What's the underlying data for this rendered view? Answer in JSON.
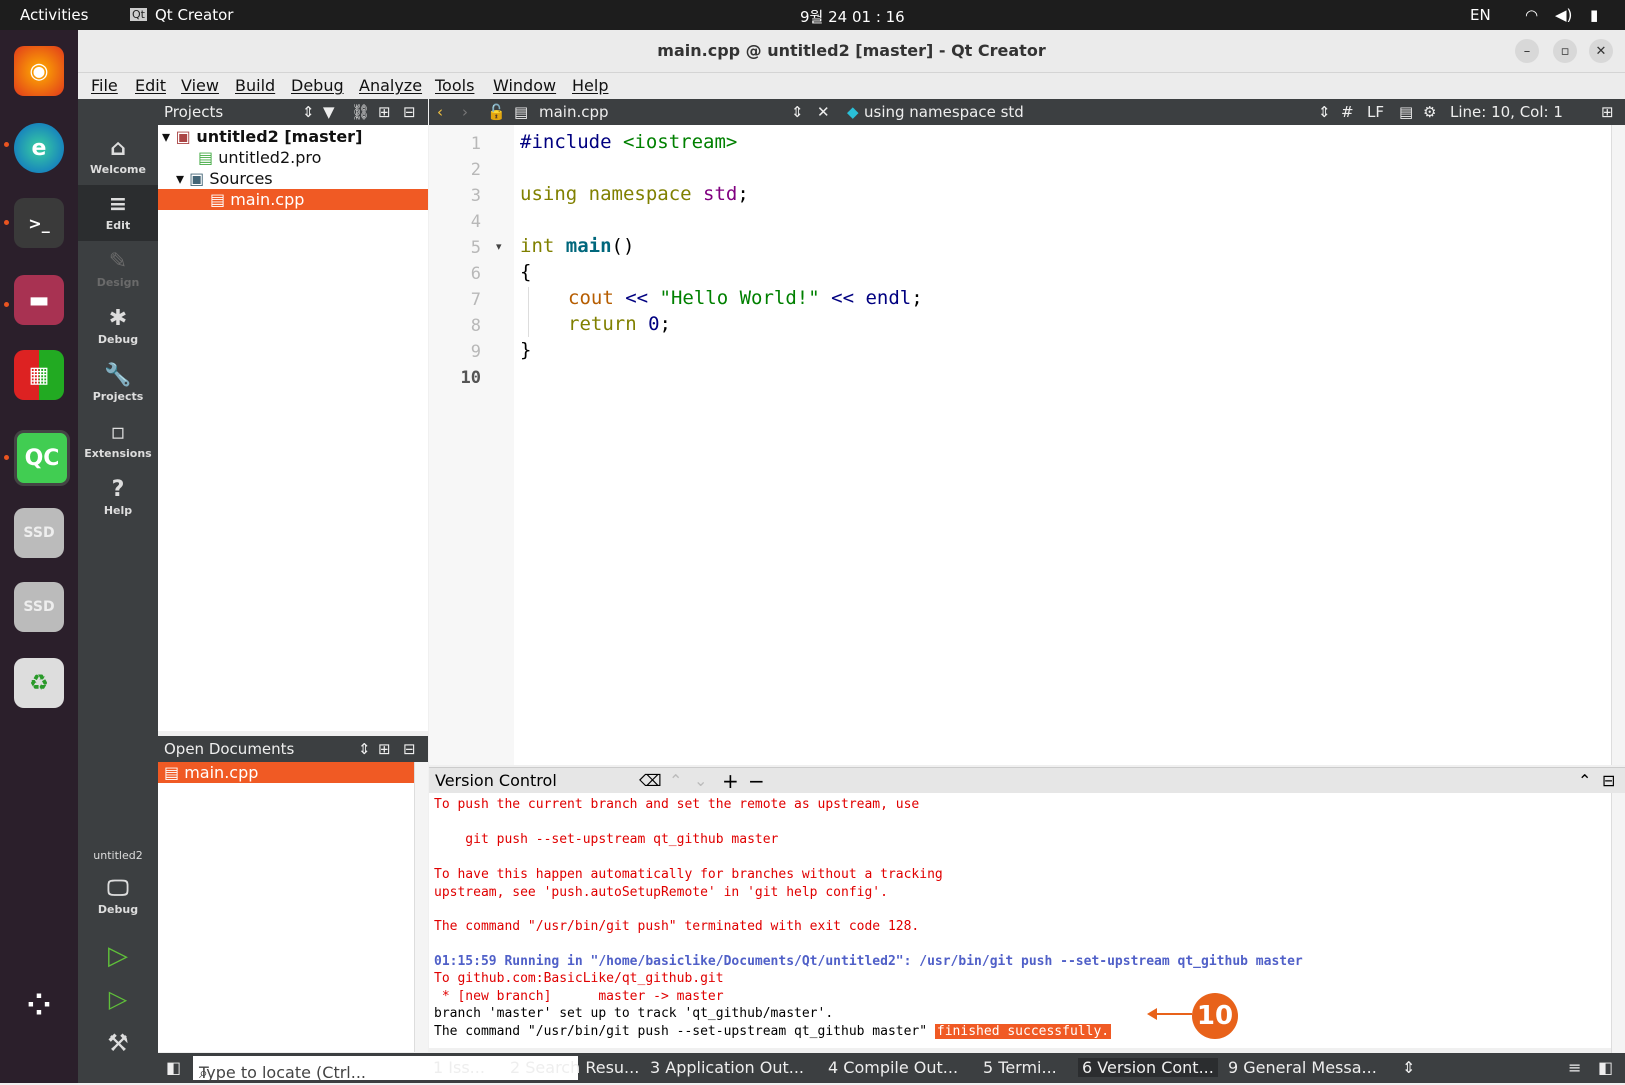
{
  "topbar": {
    "activities": "Activities",
    "app": "Qt Creator",
    "clock": "9월 24  01 : 16",
    "lang": "EN"
  },
  "window": {
    "title": "main.cpp @ untitled2 [master] - Qt Creator"
  },
  "menu": [
    "File",
    "Edit",
    "View",
    "Build",
    "Debug",
    "Analyze",
    "Tools",
    "Window",
    "Help"
  ],
  "modes": [
    {
      "label": "Welcome",
      "icon": "⌂"
    },
    {
      "label": "Edit",
      "icon": "≡"
    },
    {
      "label": "Design",
      "icon": "✎"
    },
    {
      "label": "Debug",
      "icon": "✱"
    },
    {
      "label": "Projects",
      "icon": "🔧"
    },
    {
      "label": "Extensions",
      "icon": "▫"
    },
    {
      "label": "Help",
      "icon": "?"
    }
  ],
  "kit": {
    "project": "untitled2",
    "config": "Debug"
  },
  "projects": {
    "header": "Projects",
    "items": [
      "untitled2 [master]",
      "untitled2.pro",
      "Sources",
      "main.cpp"
    ]
  },
  "open_docs": {
    "header": "Open Documents",
    "items": [
      "main.cpp"
    ]
  },
  "editor": {
    "file": "main.cpp",
    "symbol": "using namespace std",
    "hash": "#",
    "eol": "LF",
    "position": "Line: 10, Col: 1",
    "line_numbers": [
      "1",
      "2",
      "3",
      "4",
      "5",
      "6",
      "7",
      "8",
      "9",
      "10"
    ],
    "code": {
      "l1a": "#include ",
      "l1b": "<iostream>",
      "l3a": "using namespace ",
      "l3b": "std",
      "l3c": ";",
      "l5a": "int ",
      "l5b": "main",
      "l5c": "()",
      "l6": "{",
      "l7a": "cout",
      "l7b": " << ",
      "l7c": "\"Hello World!\"",
      "l7d": " << ",
      "l7e": "endl",
      "l7f": ";",
      "l8a": "return ",
      "l8b": "0",
      "l8c": ";",
      "l9": "}"
    }
  },
  "version_control": {
    "header": "Version Control",
    "lines": [
      "To push the current branch and set the remote as upstream, use",
      "    git push --set-upstream qt_github master",
      "To have this happen automatically for branches without a tracking",
      "upstream, see 'push.autoSetupRemote' in 'git help config'.",
      "The command \"/usr/bin/git push\" terminated with exit code 128.",
      "01:15:59 Running in \"/home/basiclike/Documents/Qt/untitled2\": /usr/bin/git push --set-upstream qt_github master",
      "To github.com:BasicLike/qt_github.git",
      " * [new branch]      master -> master",
      "branch 'master' set up to track 'qt_github/master'.",
      "The command \"/usr/bin/git push --set-upstream qt_github master\" "
    ],
    "success": "finished successfully.",
    "annotation": "10"
  },
  "statusbar": {
    "locate_placeholder": "Type to locate (Ctrl...",
    "tabs": [
      "1 Iss...",
      "2 Search Resu...",
      "3 Application Out...",
      "4 Compile Out...",
      "5 Termi...",
      "6 Version Cont...",
      "9 General Messa..."
    ]
  },
  "colors": {
    "accent": "#f05a24",
    "dock": "#2b1f2b",
    "sidebar": "#3c3f41"
  }
}
